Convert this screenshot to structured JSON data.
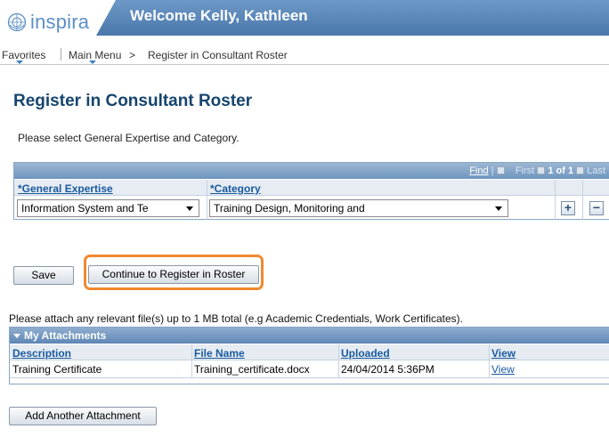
{
  "header": {
    "logo_text": "inspira",
    "welcome": "Welcome Kelly, Kathleen",
    "bar_color": "#5b87b8"
  },
  "menu": {
    "favorites": "Favorites",
    "main_menu": "Main Menu",
    "separator": ">",
    "breadcrumb": "Register in Consultant Roster"
  },
  "page": {
    "title": "Register in Consultant Roster",
    "instruction": "Please select General Expertise and Category."
  },
  "grid": {
    "nav": {
      "find": "Find",
      "first": "First",
      "count": "1 of 1",
      "last": "Last"
    },
    "columns": [
      "*General Expertise",
      "*Category"
    ],
    "row": {
      "expertise": "Information System and Te",
      "category": "Training Design, Monitoring and"
    },
    "add_label": "+",
    "remove_label": "−"
  },
  "buttons": {
    "save": "Save",
    "continue": "Continue to Register in Roster",
    "highlight_color": "#f0892f"
  },
  "attachments": {
    "note": "Please attach any relevant file(s) up to 1 MB total (e.g Academic Credentials, Work Certificates).",
    "title": "My Attachments",
    "columns": [
      "Description",
      "File Name",
      "Uploaded",
      "View"
    ],
    "rows": [
      {
        "description": "Training Certificate",
        "file_name": "Training_certificate.docx",
        "uploaded": "24/04/2014  5:36PM",
        "view": "View"
      }
    ],
    "add_button": "Add Another Attachment"
  }
}
